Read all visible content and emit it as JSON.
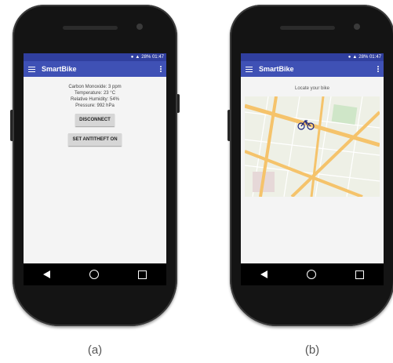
{
  "phones": {
    "a": {
      "status_text": "28% 01:47",
      "app_title": "SmartBike",
      "readings": [
        "Carbon Monoxide: 3 ppm",
        "Temperature: 23 °C",
        "Relative Humidity: 54%",
        "Pressure: 992 hPa"
      ],
      "disconnect_label": "DISCONNECT",
      "antitheft_label": "SET ANTITHEFT ON",
      "caption": "(a)"
    },
    "b": {
      "status_text": "28% 01:47",
      "app_title": "SmartBike",
      "locate_text": "Locate your bike",
      "caption": "(b)"
    }
  },
  "icons": {
    "menu": "hamburger-icon",
    "overflow": "more-vert-icon",
    "back": "back-icon",
    "home": "home-icon",
    "recents": "recents-icon",
    "bike_marker": "bicycle-icon"
  },
  "colors": {
    "status_bar": "#303f9f",
    "app_bar": "#3f51b5",
    "map_road_major": "#f5c36b",
    "map_park": "#cfe6c8"
  }
}
